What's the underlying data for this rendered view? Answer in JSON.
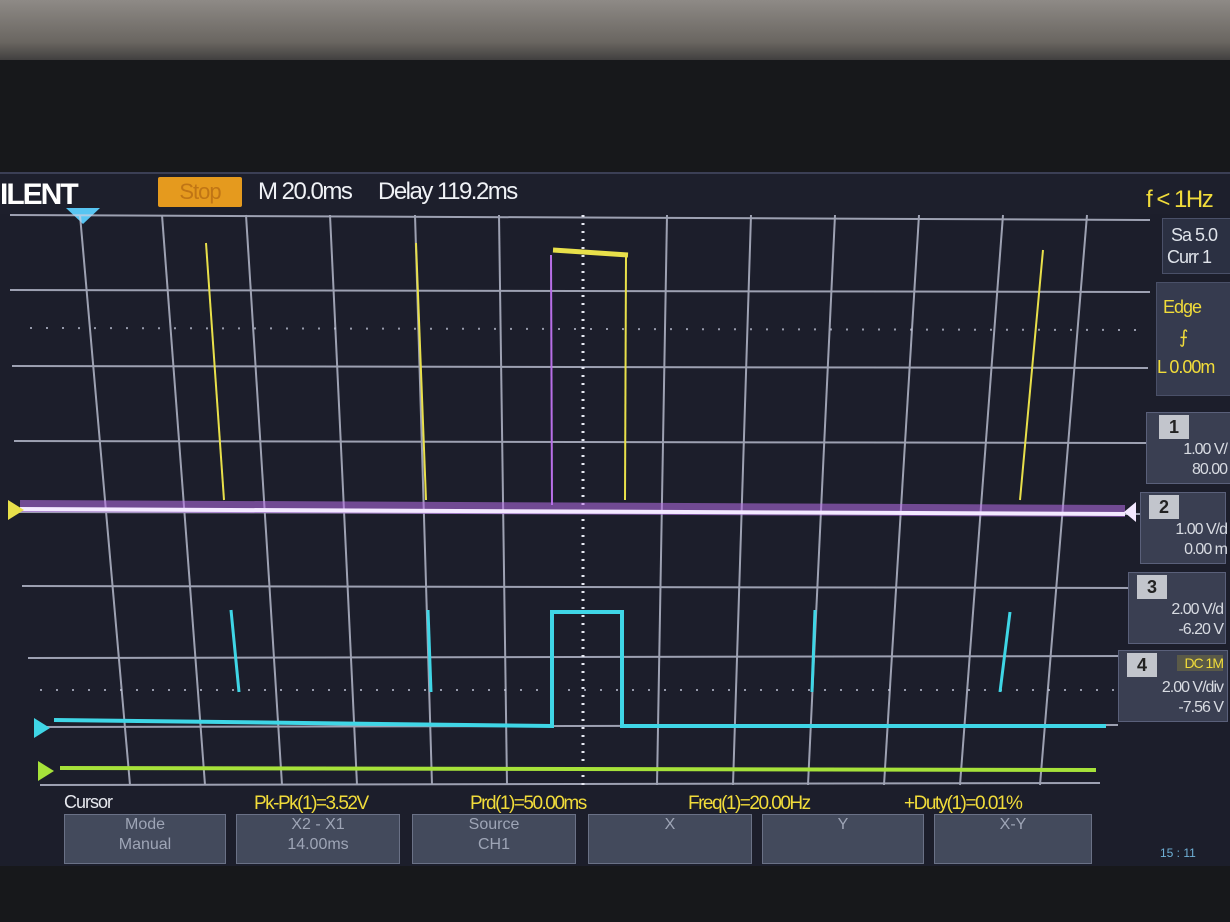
{
  "header": {
    "brand": "ILENT",
    "run_state": "Stop",
    "timebase": "M 20.0ms",
    "delay": "Delay 119.2ms",
    "trigger_freq": "f < 1Hz"
  },
  "side_panel": {
    "acq_line1": "Sa 5.0",
    "acq_line2": "Curr 1",
    "trigger_type": "Edge",
    "trigger_slope": "⨍",
    "trigger_level": "L  0.00m",
    "channels": [
      {
        "num": "1",
        "scale": "1.00 V/",
        "offset": "80.00"
      },
      {
        "num": "2",
        "scale": "1.00 V/d",
        "offset": "0.00 m"
      },
      {
        "num": "3",
        "scale": "2.00 V/d",
        "offset": "-6.20 V"
      },
      {
        "num": "4",
        "tag": "DC 1M",
        "scale": "2.00 V/div",
        "offset": "-7.56 V"
      }
    ]
  },
  "measurements": {
    "menu_title": "Cursor",
    "pkpk": "Pk-Pk(1)=3.52V",
    "period": "Prd(1)=50.00ms",
    "freq": "Freq(1)=20.00Hz",
    "duty": "+Duty(1)=0.01%"
  },
  "softkeys": [
    {
      "line1": "Mode",
      "line2": "Manual"
    },
    {
      "line1": "X2 - X1",
      "line2": "14.00ms"
    },
    {
      "line1": "Source",
      "line2": "CH1"
    },
    {
      "line1": "X",
      "line2": ""
    },
    {
      "line1": "Y",
      "line2": ""
    },
    {
      "line1": "X-Y",
      "line2": ""
    }
  ],
  "clock": "15 : 11",
  "colors": {
    "ch1": "#e8e04a",
    "ch2": "#b86fe8",
    "ch3": "#3fd6e6",
    "ch4": "#a6e23a",
    "accent": "#e59a1e",
    "grid": "#c9cde0"
  }
}
